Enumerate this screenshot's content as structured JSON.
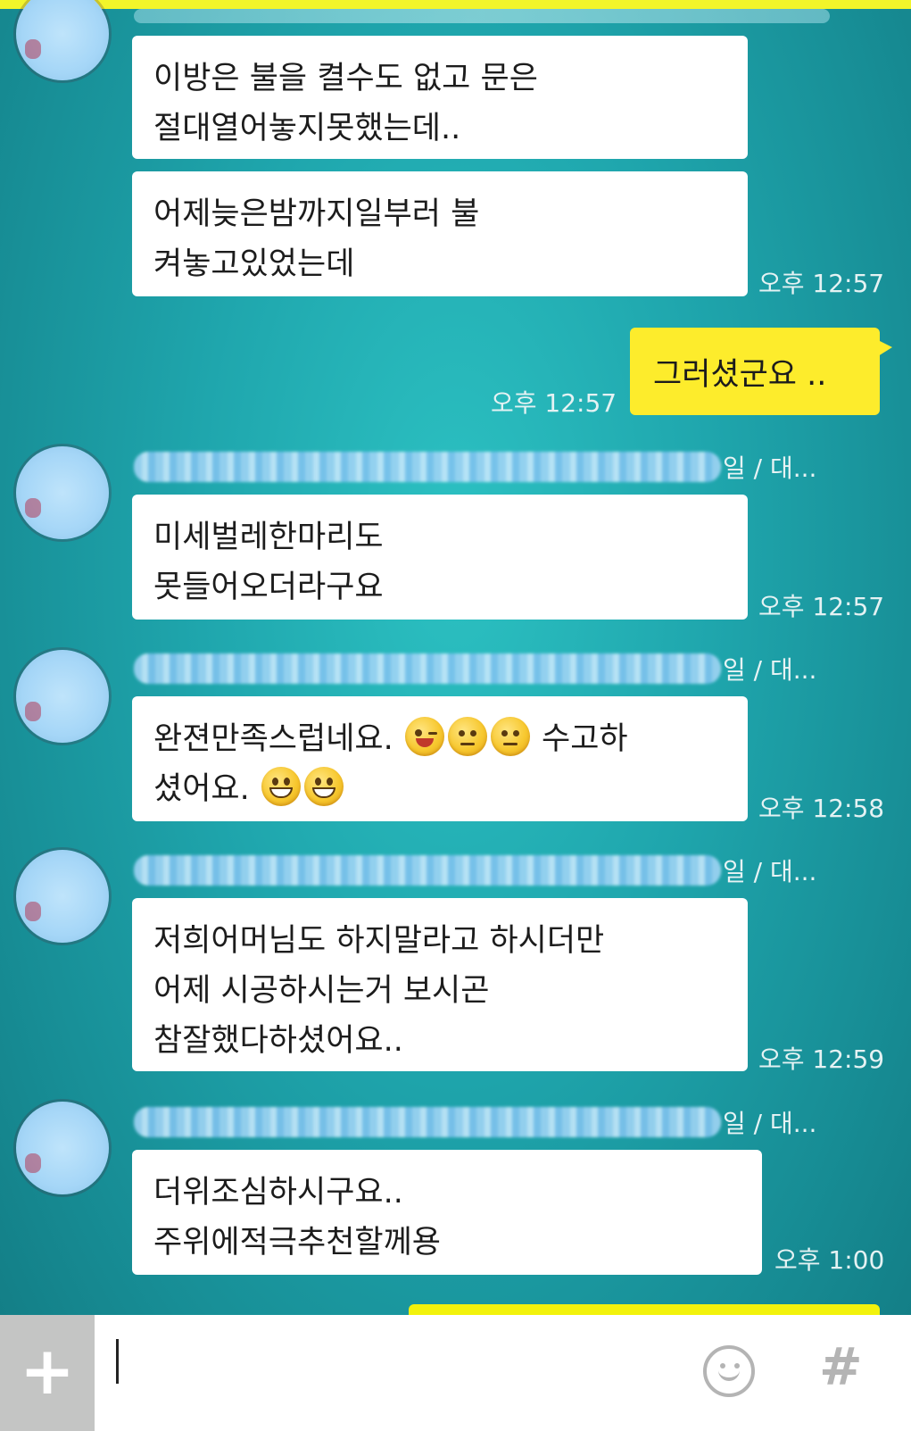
{
  "chat": {
    "messages": [
      {
        "sender": "other",
        "name_suffix": "일 / 대...",
        "bubbles": [
          {
            "lines": [
              "이방은 불을 켤수도 없고 문은",
              "절대열어놓지못했는데.."
            ]
          },
          {
            "lines": [
              "어제늦은밤까지일부러 불",
              "켜놓고있었는데"
            ]
          }
        ],
        "time": "오후 12:57"
      },
      {
        "sender": "me",
        "text": "그러셨군요 ..",
        "time": "오후 12:57"
      },
      {
        "sender": "other",
        "name_suffix": "일 / 대...",
        "bubbles": [
          {
            "lines": [
              "미세벌레한마리도",
              "못들어오더라구요"
            ]
          }
        ],
        "time": "오후 12:57"
      },
      {
        "sender": "other",
        "name_suffix": "일 / 대...",
        "bubbles": [
          {
            "lines": [
              "완젼만족스럽네요.",
              "수고하",
              "셨어요."
            ]
          }
        ],
        "emojis": [
          "wink-emoji",
          "neutral-emoji",
          "neutral-emoji",
          "grin-emoji",
          "grin-emoji"
        ],
        "time": "오후 12:58"
      },
      {
        "sender": "other",
        "name_suffix": "일 / 대...",
        "bubbles": [
          {
            "lines": [
              "저희어머님도 하지말라고 하시더만",
              "어제 시공하시는거 보시곤",
              "참잘했다하셨어요.."
            ]
          }
        ],
        "time": "오후 12:59"
      },
      {
        "sender": "other",
        "name_suffix": "일 / 대...",
        "bubbles": [
          {
            "lines": [
              "더위조심하시구요..",
              "주위에적극추천할께용"
            ]
          }
        ],
        "time": "오후 1:00"
      }
    ]
  },
  "input_bar": {
    "plus_label": "+",
    "emoji_icon": "smiley-icon",
    "hash_label": "#"
  },
  "colors": {
    "background": "#1fa6ad",
    "my_bubble": "#fdec2c",
    "other_bubble": "#ffffff",
    "time_text": "#e4f2f3"
  }
}
